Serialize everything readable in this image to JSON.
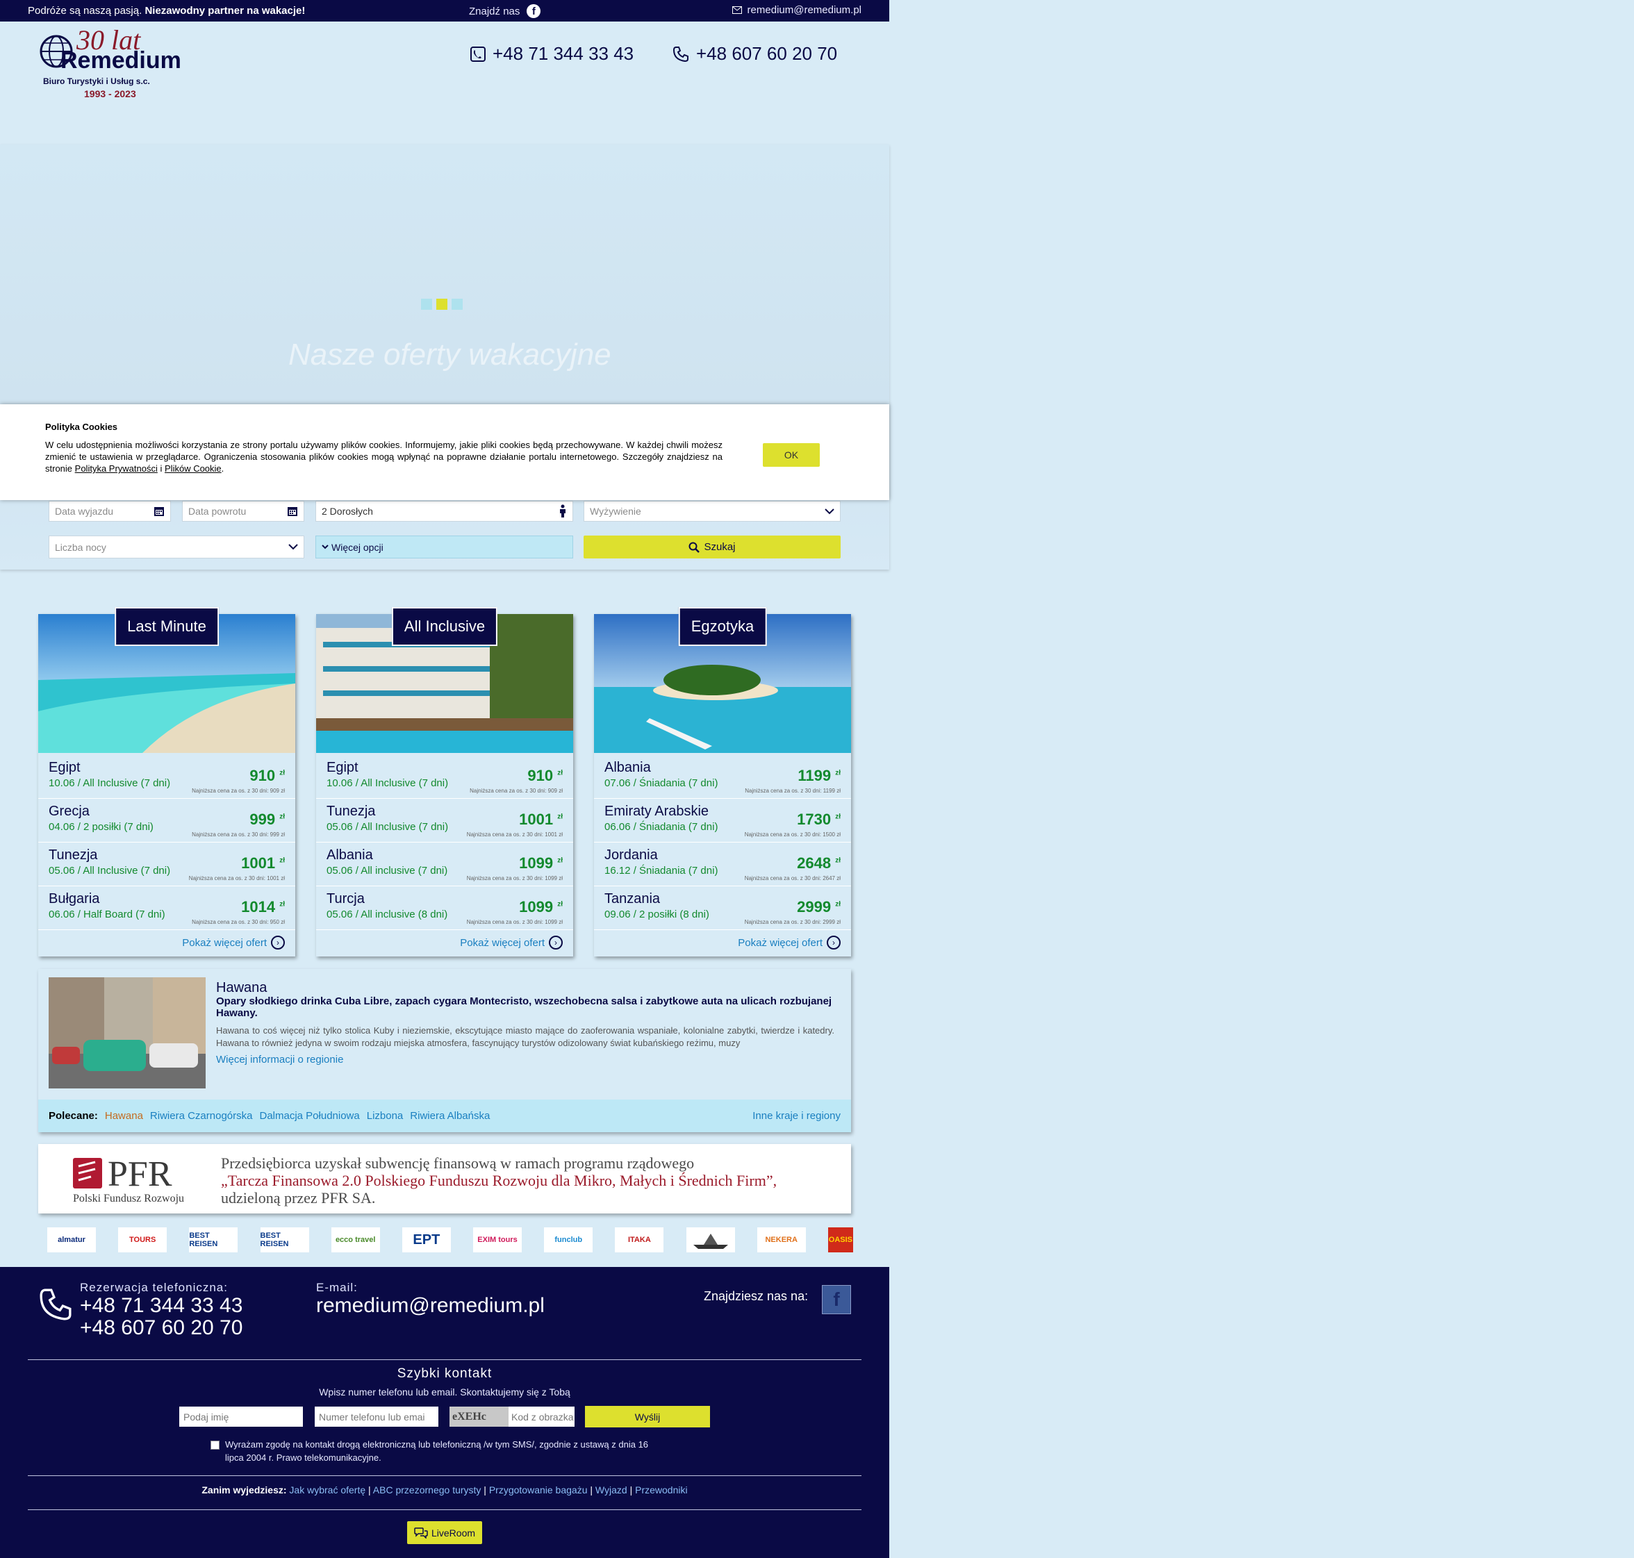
{
  "topbar": {
    "tagline_normal": "Podróże są naszą pasją.",
    "tagline_bold": "Niezawodny partner na wakacje!",
    "find_us": "Znajdź nas",
    "email": "remedium@remedium.pl"
  },
  "header": {
    "logo": {
      "years": "30 lat",
      "name": "Remedium",
      "sub": "Biuro Turystyki i Usług s.c.",
      "dates": "1993 - 2023"
    },
    "phone1": "+48 71 344 33 43",
    "phone2": "+48 607 60 20 70"
  },
  "hero": {
    "title": "Nasze oferty wakacyjne"
  },
  "cookie": {
    "title": "Polityka Cookies",
    "text": "W celu udostępnienia możliwości korzystania ze strony portalu używamy plików cookies. Informujemy, jakie pliki cookies będą przechowywane. W każdej chwili możesz zmienić te ustawienia w przeglądarce. Ograniczenia stosowania plików cookies mogą wpłynąć na poprawne działanie portalu internetowego. Szczegóły znajdziesz na stronie",
    "link1": "Polityka Prywatności",
    "and": "i",
    "link2": "Plików Cookie",
    "ok": "OK"
  },
  "search": {
    "departure_placeholder": "Data wyjazdu",
    "return_placeholder": "Data powrotu",
    "people_value": "2 Dorosłych",
    "board_placeholder": "Wyżywienie",
    "nights_placeholder": "Liczba nocy",
    "more_options": "Więcej opcji",
    "search_button": "Szukaj"
  },
  "offers": [
    {
      "tag": "Last Minute",
      "items": [
        {
          "dest": "Egipt",
          "det": "10.06 / All Inclusive (7 dni)",
          "price": "910",
          "low": "Najniższa cena za os. z 30 dni: 909 zł"
        },
        {
          "dest": "Grecja",
          "det": "04.06 / 2 posiłki (7 dni)",
          "price": "999",
          "low": "Najniższa cena za os. z 30 dni: 999 zł"
        },
        {
          "dest": "Tunezja",
          "det": "05.06 / All Inclusive (7 dni)",
          "price": "1001",
          "low": "Najniższa cena za os. z 30 dni: 1001 zł"
        },
        {
          "dest": "Bułgaria",
          "det": "06.06 / Half Board (7 dni)",
          "price": "1014",
          "low": "Najniższa cena za os. z 30 dni: 950 zł"
        }
      ],
      "more": "Pokaż więcej ofert"
    },
    {
      "tag": "All Inclusive",
      "items": [
        {
          "dest": "Egipt",
          "det": "10.06 / All Inclusive (7 dni)",
          "price": "910",
          "low": "Najniższa cena za os. z 30 dni: 909 zł"
        },
        {
          "dest": "Tunezja",
          "det": "05.06 / All Inclusive (7 dni)",
          "price": "1001",
          "low": "Najniższa cena za os. z 30 dni: 1001 zł"
        },
        {
          "dest": "Albania",
          "det": "05.06 / All inclusive (7 dni)",
          "price": "1099",
          "low": "Najniższa cena za os. z 30 dni: 1099 zł"
        },
        {
          "dest": "Turcja",
          "det": "05.06 / All inclusive (8 dni)",
          "price": "1099",
          "low": "Najniższa cena za os. z 30 dni: 1099 zł"
        }
      ],
      "more": "Pokaż więcej ofert"
    },
    {
      "tag": "Egzotyka",
      "items": [
        {
          "dest": "Albania",
          "det": "07.06 / Śniadania (7 dni)",
          "price": "1199",
          "low": "Najniższa cena za os. z 30 dni: 1199 zł"
        },
        {
          "dest": "Emiraty Arabskie",
          "det": "06.06 / Śniadania (7 dni)",
          "price": "1730",
          "low": "Najniższa cena za os. z 30 dni: 1500 zł"
        },
        {
          "dest": "Jordania",
          "det": "16.12 / Śniadania (7 dni)",
          "price": "2648",
          "low": "Najniższa cena za os. z 30 dni: 2647 zł"
        },
        {
          "dest": "Tanzania",
          "det": "09.06 / 2 posiłki (8 dni)",
          "price": "2999",
          "low": "Najniższa cena za os. z 30 dni: 2999 zł"
        }
      ],
      "more": "Pokaż więcej ofert"
    }
  ],
  "currency": "zł",
  "region": {
    "title": "Hawana",
    "lead": "Opary słodkiego drinka Cuba Libre, zapach cygara Montecristo, wszechobecna salsa i zabytkowe auta na ulicach rozbujanej Hawany.",
    "desc": "Hawana to coś więcej niż tylko stolica Kuby i nieziemskie, ekscytujące miasto mające do zaoferowania wspaniałe, kolonialne zabytki, twierdze i katedry. Hawana to również jedyna w swoim rodzaju miejska atmosfera, fascynujący turystów odizolowany świat kubańskiego reżimu, muzy",
    "more": "Więcej informacji o regionie",
    "recommended_label": "Polecane:",
    "recommended": [
      "Hawana",
      "Riwiera Czarnogórska",
      "Dalmacja Południowa",
      "Lizbona",
      "Riwiera Albańska"
    ],
    "other": "Inne kraje i regiony"
  },
  "pfr": {
    "logo": "PFR",
    "logo_sub": "Polski Fundusz Rozwoju",
    "line1": "Przedsiębiorca uzyskał subwencję finansową w ramach programu rządowego",
    "line2": "„Tarcza Finansowa 2.0 Polskiego Funduszu Rozwoju dla Mikro, Małych i Średnich Firm”,",
    "line3": "udzieloną przez PFR SA."
  },
  "partners": [
    "almatur",
    "TOURS",
    "BEST REISEN",
    "BEST REISEN",
    "ecco travel",
    "EPT",
    "EXIM tours",
    "funclub",
    "ITAKA",
    "",
    "NEKERA",
    "OASIS"
  ],
  "footer": {
    "phone_label": "Rezerwacja telefoniczna:",
    "phone1": "+48 71 344 33 43",
    "phone2": "+48 607 60 20 70",
    "email_label": "E-mail:",
    "email": "remedium@remedium.pl",
    "find_us": "Znajdziesz nas na:",
    "quick_title": "Szybki kontakt",
    "quick_sub": "Wpisz numer telefonu lub email. Skontaktujemy się z Tobą",
    "name_placeholder": "Podaj imię",
    "phone_placeholder": "Numer telefonu lub emai",
    "captcha_text": "eXEHc",
    "captcha_placeholder": "Kod z obrazka",
    "send": "Wyślij",
    "consent": "Wyrażam zgodę na kontakt drogą elektroniczną lub telefoniczną /w tym SMS/, zgodnie z ustawą z dnia 16 lipca 2004 r. Prawo telekomunikacyjne.",
    "before_label": "Zanim wyjedziesz:",
    "before_links": [
      "Jak wybrać ofertę",
      "ABC przezornego turysty",
      "Przygotowanie bagażu",
      "Wyjazd",
      "Przewodniki"
    ],
    "liveroom": "LiveRoom"
  },
  "colors": {
    "navy": "#0a0a45",
    "accent": "#dde02e",
    "price": "#138a2e",
    "link": "#1a7fc0",
    "background": "#d8ebf6"
  }
}
